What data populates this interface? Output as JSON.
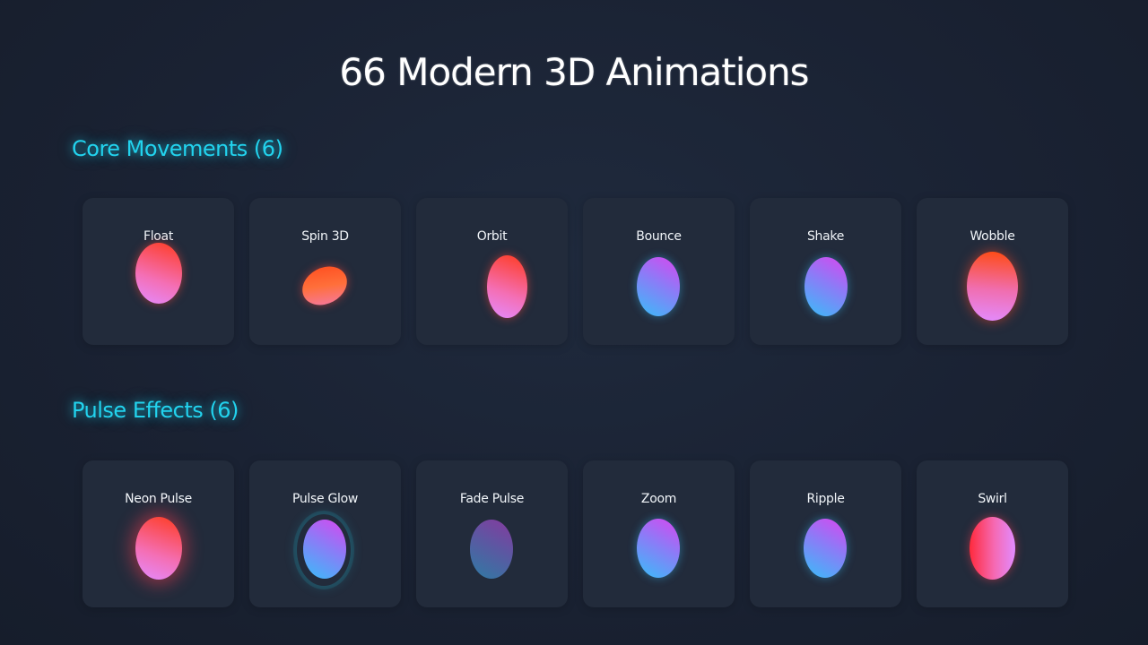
{
  "page": {
    "title": "66 Modern 3D Animations"
  },
  "sections": [
    {
      "heading": "Core Movements (6)",
      "cards": [
        {
          "label": "Float",
          "orb": "warm"
        },
        {
          "label": "Spin 3D",
          "orb": "warm"
        },
        {
          "label": "Orbit",
          "orb": "warm"
        },
        {
          "label": "Bounce",
          "orb": "cool"
        },
        {
          "label": "Shake",
          "orb": "cool"
        },
        {
          "label": "Wobble",
          "orb": "warm"
        }
      ]
    },
    {
      "heading": "Pulse Effects (6)",
      "cards": [
        {
          "label": "Neon Pulse",
          "orb": "warm"
        },
        {
          "label": "Pulse Glow",
          "orb": "cool"
        },
        {
          "label": "Fade Pulse",
          "orb": "cool"
        },
        {
          "label": "Zoom",
          "orb": "cool"
        },
        {
          "label": "Ripple",
          "orb": "cool"
        },
        {
          "label": "Swirl",
          "orb": "warm"
        }
      ]
    }
  ],
  "colors": {
    "background": "#1a2233",
    "card": "#222b3b",
    "heading_accent": "#22d3ee",
    "warm_gradient": [
      "#ff3b1f",
      "#f46fb5",
      "#e38bff"
    ],
    "cool_gradient": [
      "#d946ef",
      "#8b7cf7",
      "#38bdf8"
    ]
  }
}
